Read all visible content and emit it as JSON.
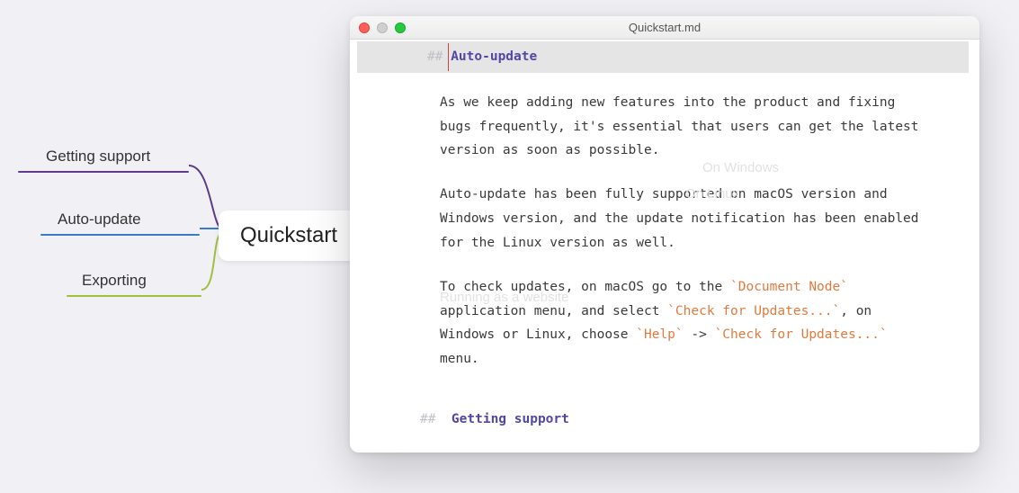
{
  "mindmap": {
    "root": "Quickstart",
    "branches": {
      "getting_support": "Getting support",
      "auto_update": "Auto-update",
      "exporting": "Exporting"
    },
    "faded": {
      "on_windows": "On Windows",
      "on_linux": "On Linux",
      "running_website": "Running as a website"
    }
  },
  "window": {
    "title": "Quickstart.md"
  },
  "editor": {
    "heading": {
      "hashes": "##",
      "text": "Auto-update"
    },
    "para1": "As we keep adding new features into the product and fixing bugs frequently, it's essential that users can get the latest version as soon as possible.",
    "para2": "Auto-update has been fully supported on macOS version and Windows version, and the update notification has been enabled for the Linux version as well.",
    "para3_a": "To check updates, on macOS go to the ",
    "para3_code1": "`Document Node`",
    "para3_b": " application menu, and select ",
    "para3_code2": "`Check for Updates...`",
    "para3_c": ", on Windows or Linux, choose ",
    "para3_code3": "`Help`",
    "para3_d": " -> ",
    "para3_code4": "`Check for Updates...`",
    "para3_e": " menu.",
    "heading2": {
      "hashes": "##",
      "text": "Getting support"
    }
  }
}
